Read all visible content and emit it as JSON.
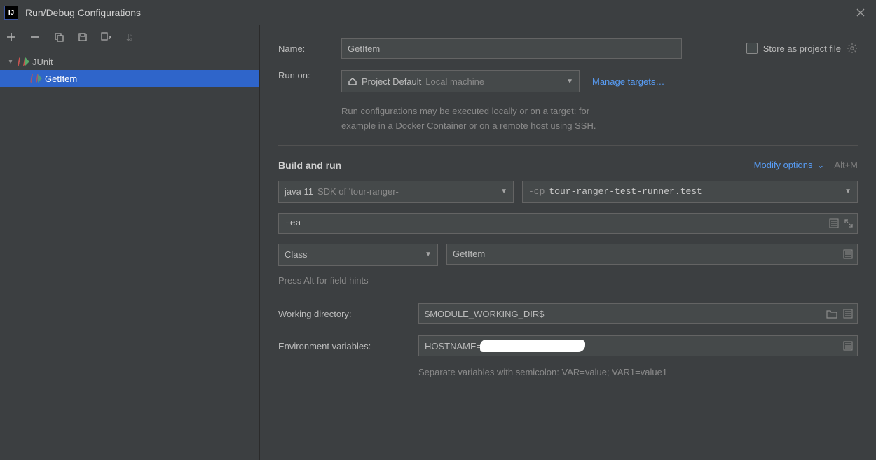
{
  "window": {
    "title": "Run/Debug Configurations"
  },
  "sidebar": {
    "root_label": "JUnit",
    "item_label": "GetItem"
  },
  "name": {
    "label": "Name:",
    "value": "GetItem",
    "store_label": "Store as project file"
  },
  "runon": {
    "label": "Run on:",
    "value_main": "Project Default",
    "value_sub": "Local machine",
    "manage": "Manage targets…",
    "hint1": "Run configurations may be executed locally or on a target: for",
    "hint2": "example in a Docker Container or on a remote host using SSH."
  },
  "build": {
    "title": "Build and run",
    "modify": "Modify options",
    "shortcut": "Alt+M",
    "jdk_main": "java 11",
    "jdk_sub": "SDK of 'tour-ranger-",
    "cp_flag": "-cp",
    "cp_value": "tour-ranger-test-runner.test",
    "vm_opts": "-ea",
    "scope": "Class",
    "class_name": "GetItem",
    "hints": "Press Alt for field hints"
  },
  "wd": {
    "label": "Working directory:",
    "value": "$MODULE_WORKING_DIR$"
  },
  "env": {
    "label": "Environment variables:",
    "value_prefix": "HOSTNAME=",
    "hint": "Separate variables with semicolon: VAR=value; VAR1=value1"
  }
}
